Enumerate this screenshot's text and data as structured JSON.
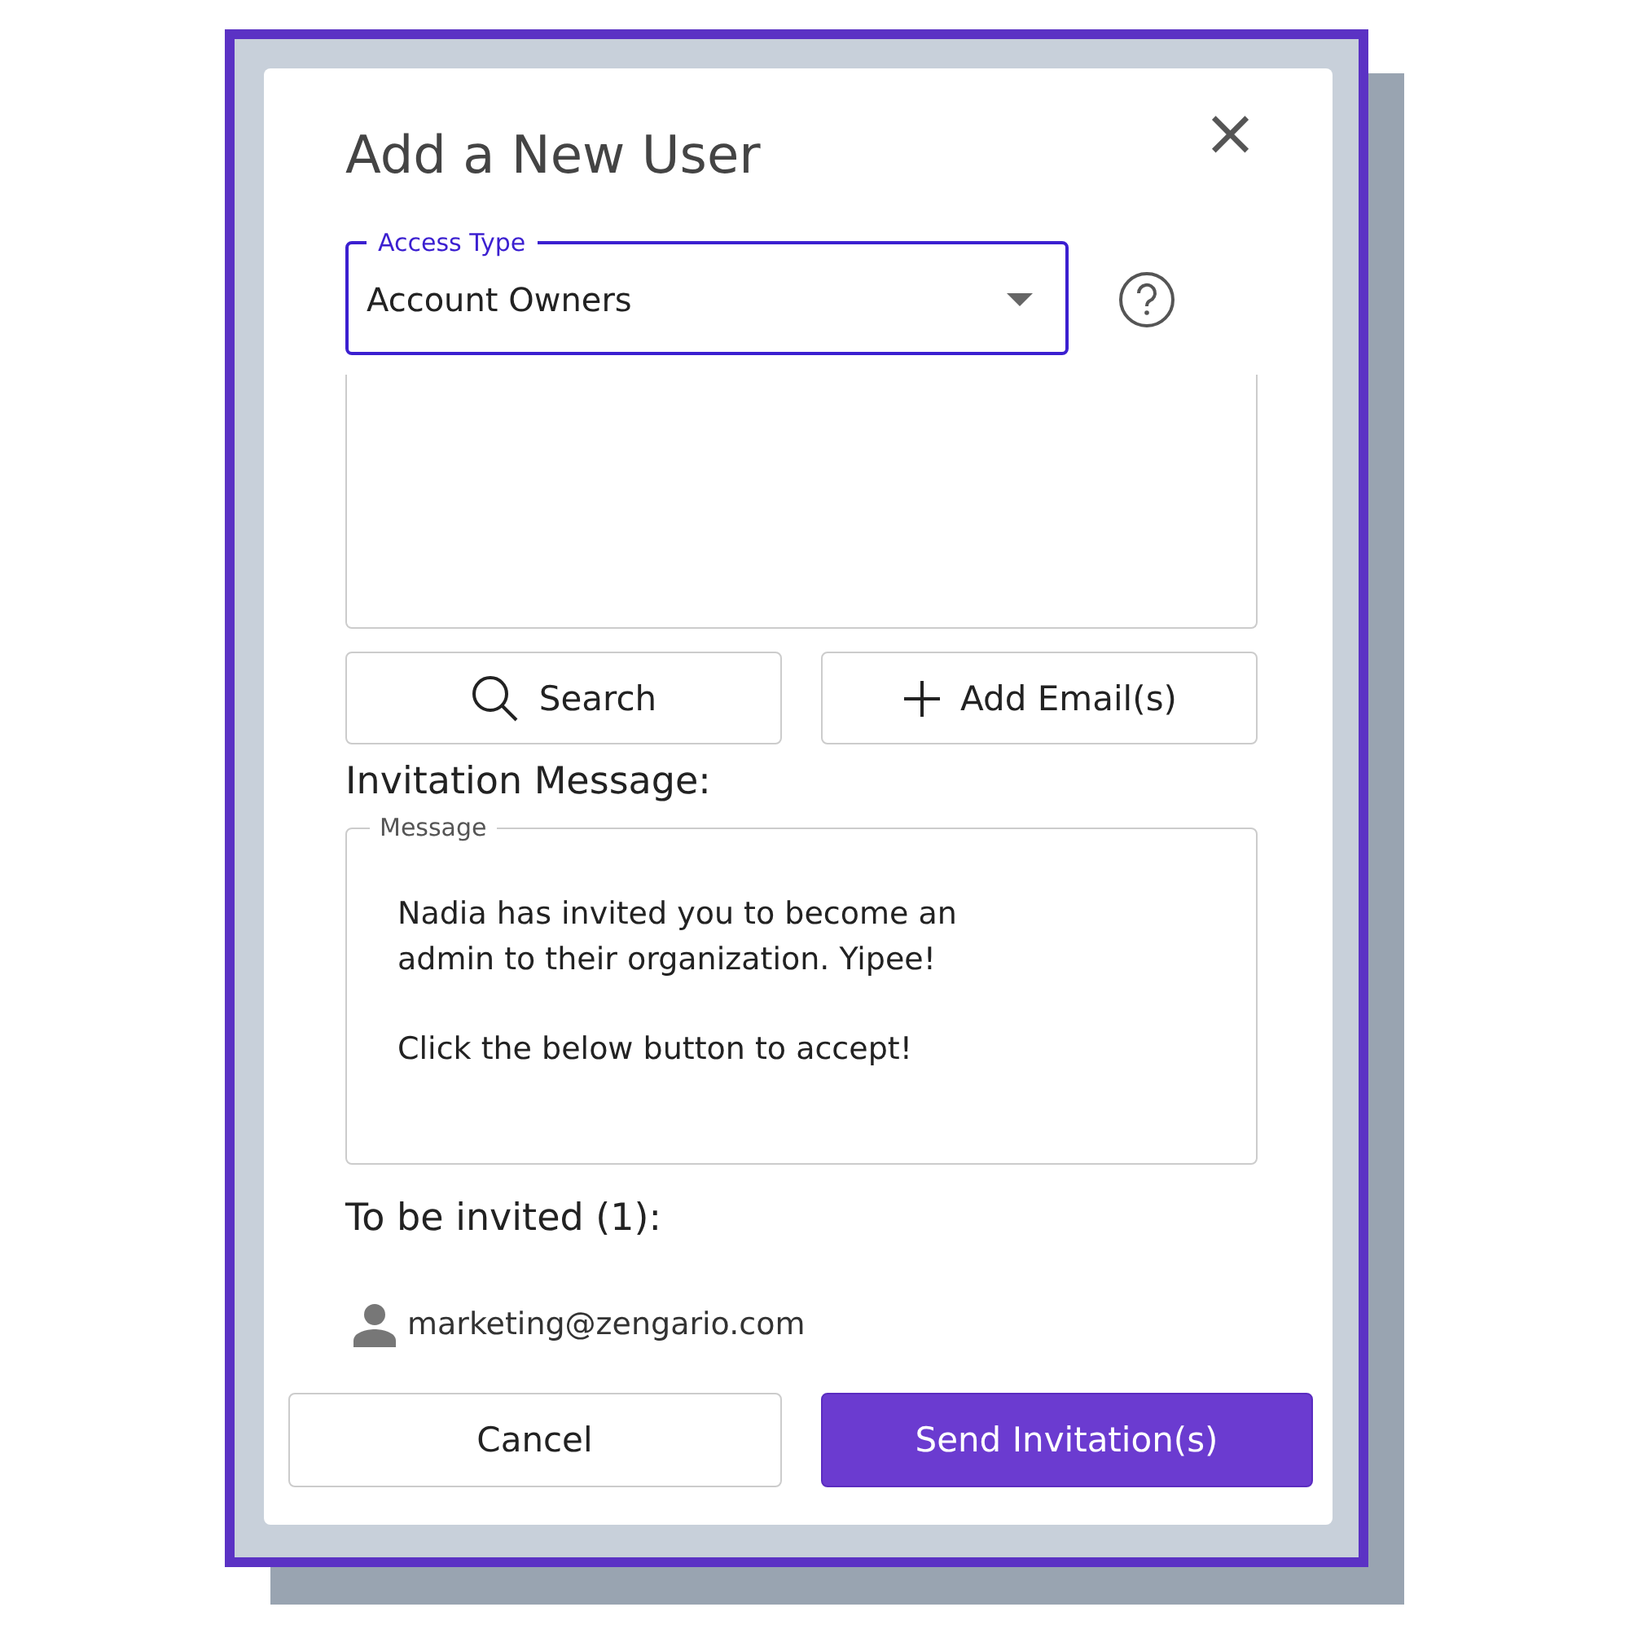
{
  "dialog": {
    "title": "Add a New User",
    "close": "×"
  },
  "access_type": {
    "label": "Access Type",
    "value": "Account Owners",
    "focused": true
  },
  "buttons": [
    {
      "kind": "search",
      "label": "Search"
    },
    {
      "kind": "add",
      "label": "Add Email(s)"
    }
  ],
  "invitation": {
    "heading": "Invitation Message:",
    "label": "Message",
    "paragraphs": [
      "Nadia has invited you to become an admin to their organization. Yipee!",
      "Click the below button to accept!"
    ]
  },
  "invitees": {
    "heading": "To be invited (1):",
    "items": [
      "marketing@zengario.com"
    ]
  },
  "footer": [
    {
      "kind": "secondary",
      "label": "Cancel"
    },
    {
      "kind": "primary",
      "label": "Send Invitation(s)"
    }
  ]
}
